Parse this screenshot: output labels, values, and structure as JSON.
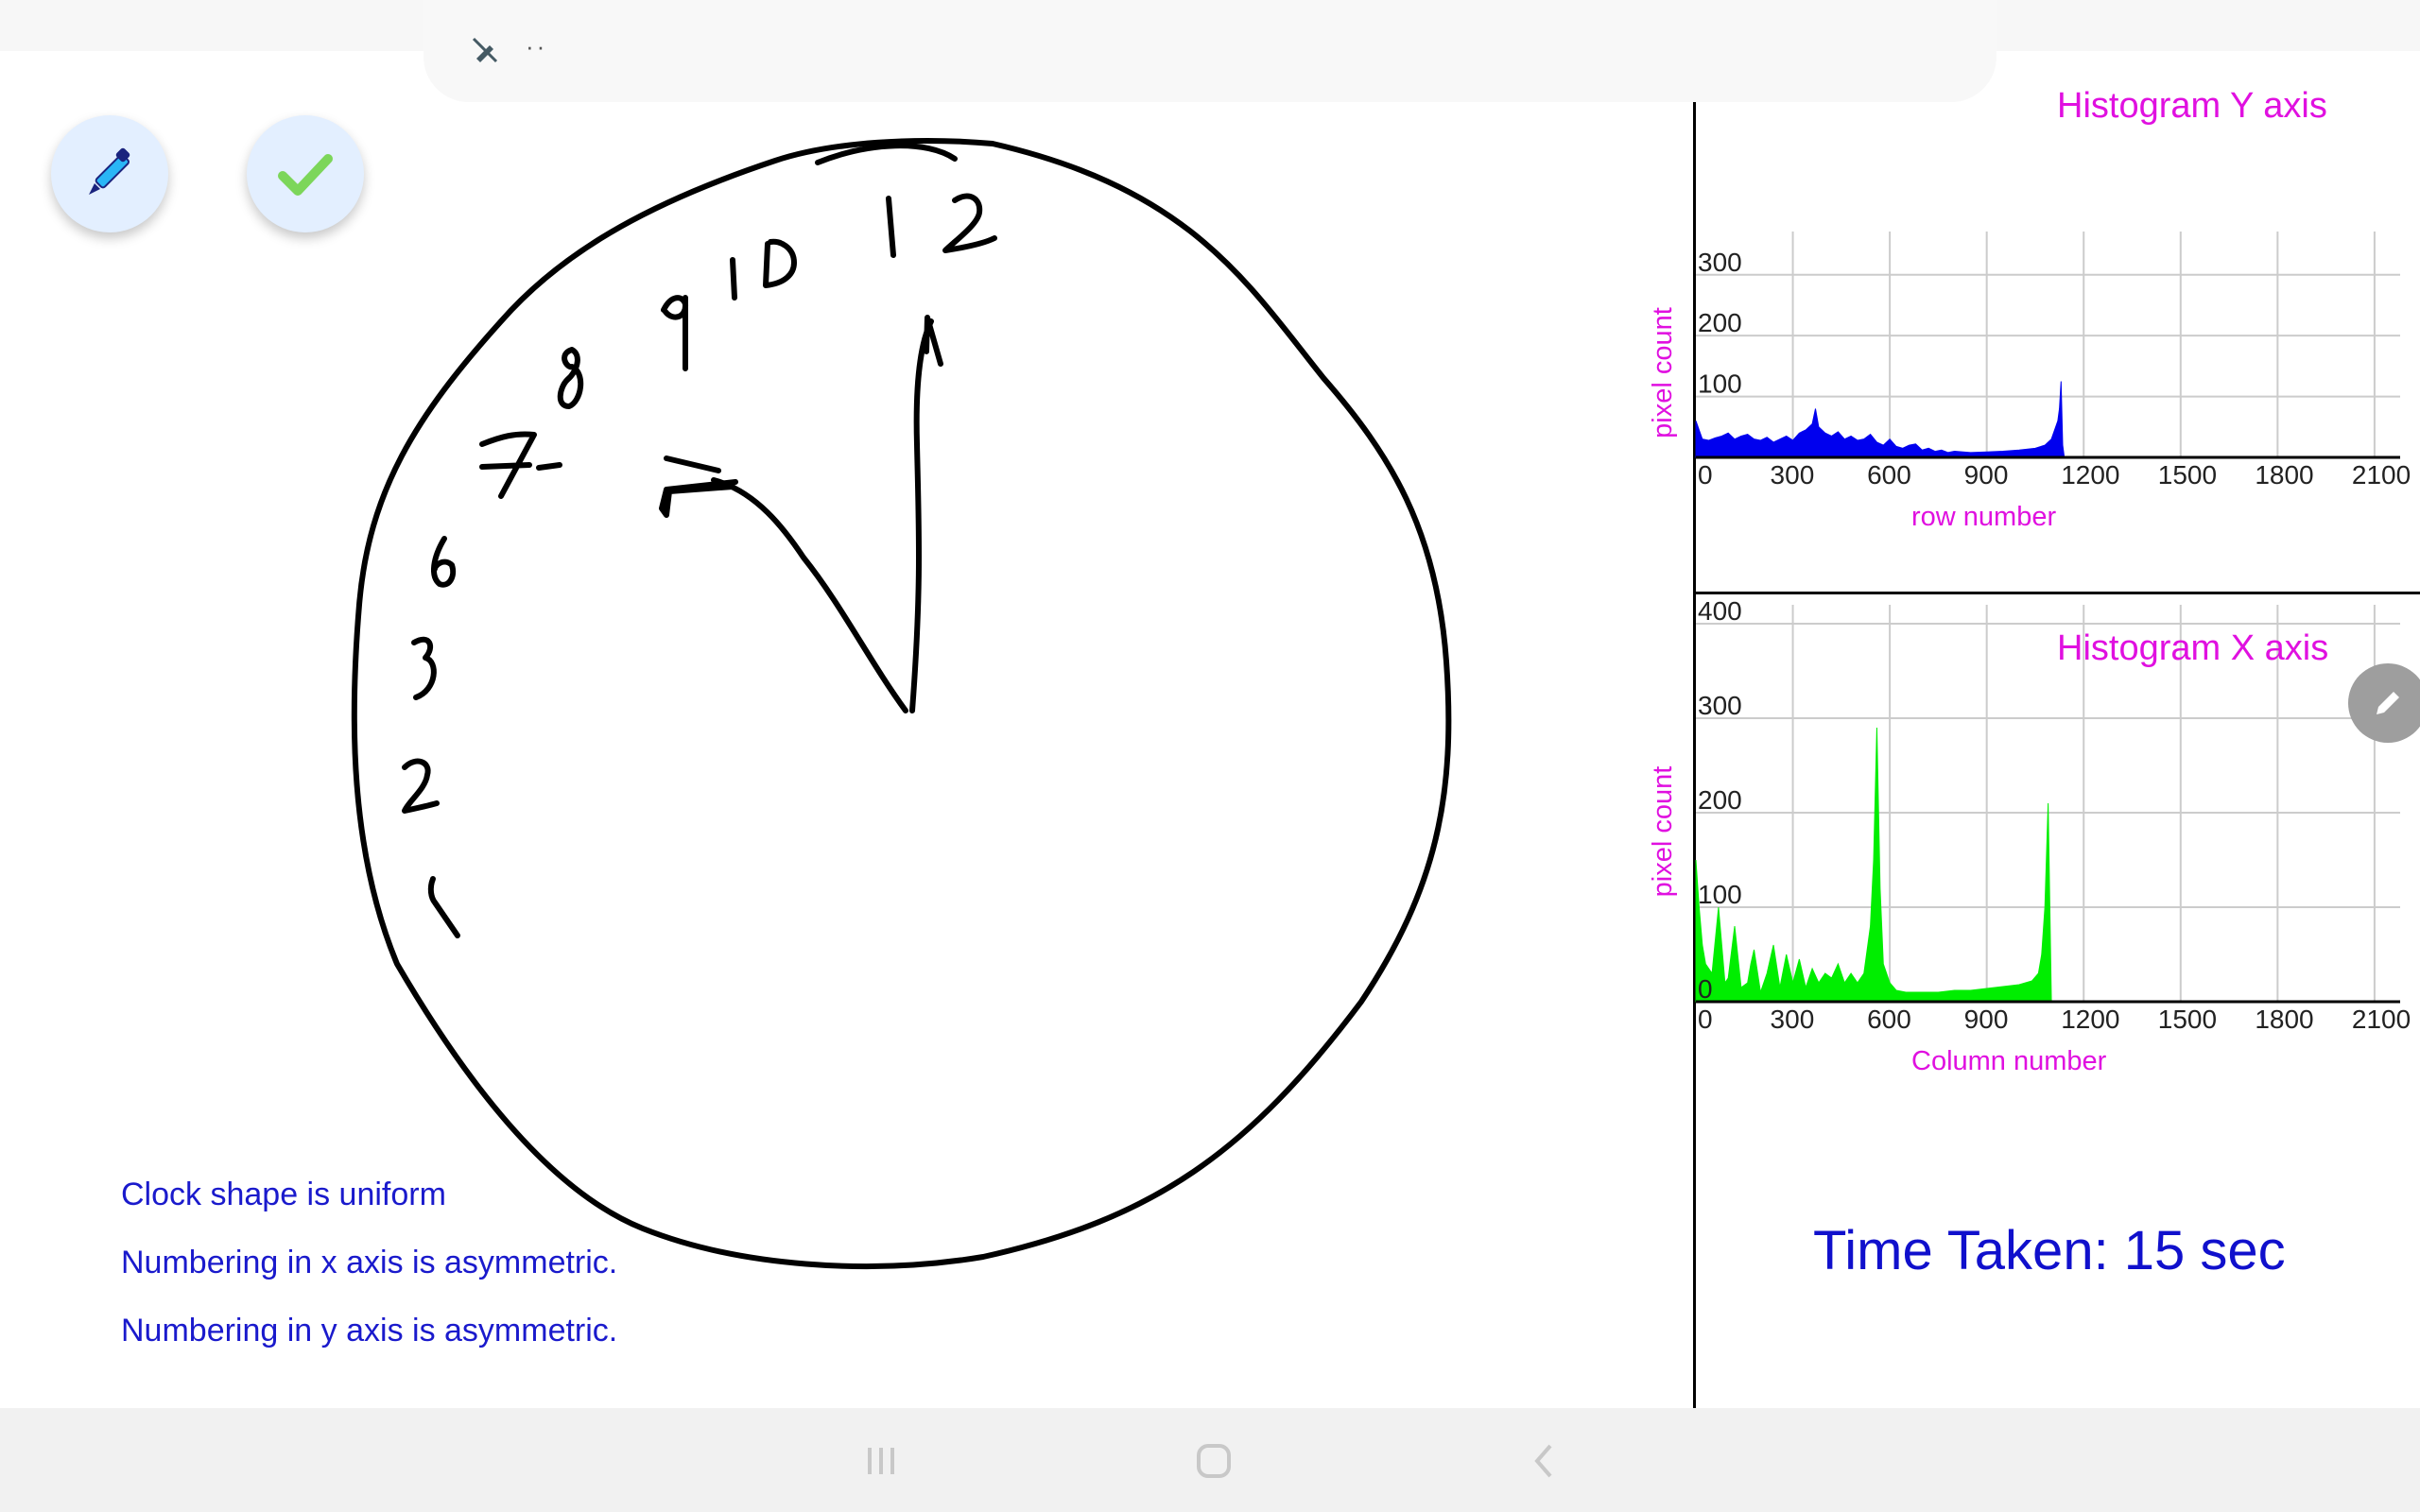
{
  "toolbar": {
    "icons": [
      "no-edit-icon",
      "more-dots-icon"
    ],
    "dots": "··"
  },
  "fabs": [
    {
      "name": "pen-tool-button",
      "icon": "pen-icon"
    },
    {
      "name": "confirm-button",
      "icon": "check-icon"
    }
  ],
  "clock_drawing": {
    "numbers": [
      "12",
      "10",
      "9",
      "8",
      "7",
      "6",
      "3",
      "2",
      "1"
    ]
  },
  "results": [
    "Clock shape is uniform",
    "Numbering in x axis is asymmetric.",
    "Numbering in y axis is asymmetric."
  ],
  "time_taken": "Time Taken: 15 sec",
  "colors": {
    "accent_text": "#e010e0",
    "result_text": "#1a1acc",
    "y_hist_fill": "#0000ee",
    "x_hist_fill": "#00ee00"
  },
  "chart_data": [
    {
      "type": "area",
      "title": "Histogram Y axis",
      "xlabel": "row number",
      "ylabel": "pixel count",
      "xlim": [
        0,
        2150
      ],
      "ylim": [
        0,
        340
      ],
      "xticks": [
        0,
        300,
        600,
        900,
        1200,
        1500,
        1800,
        2100
      ],
      "yticks": [
        100,
        200,
        300
      ],
      "grid": true,
      "series": [
        {
          "x": [
            0,
            10,
            20,
            40,
            60,
            80,
            100,
            120,
            140,
            160,
            180,
            200,
            220,
            240,
            260,
            280,
            300,
            320,
            340,
            360,
            370,
            380,
            400,
            420,
            440,
            460,
            480,
            500,
            520,
            540,
            560,
            580,
            600,
            620,
            640,
            660,
            680,
            700,
            720,
            740,
            760,
            780,
            800,
            850,
            900,
            950,
            1000,
            1050,
            1080,
            1100,
            1110,
            1120,
            1125,
            1130,
            1135,
            1140
          ],
          "y": [
            60,
            45,
            30,
            28,
            32,
            35,
            40,
            30,
            35,
            38,
            30,
            28,
            33,
            25,
            30,
            35,
            28,
            40,
            45,
            55,
            80,
            50,
            40,
            35,
            42,
            30,
            35,
            28,
            30,
            38,
            25,
            20,
            30,
            18,
            15,
            20,
            22,
            12,
            15,
            10,
            12,
            8,
            10,
            8,
            9,
            10,
            12,
            15,
            20,
            30,
            45,
            60,
            80,
            125,
            20,
            0
          ]
        }
      ]
    },
    {
      "type": "area",
      "title": "Histogram X axis",
      "xlabel": "Column number",
      "ylabel": "pixel count",
      "xlim": [
        0,
        2150
      ],
      "ylim": [
        0,
        400
      ],
      "xticks": [
        0,
        300,
        600,
        900,
        1200,
        1500,
        1800,
        2100
      ],
      "yticks": [
        0,
        100,
        200,
        300,
        400
      ],
      "grid": true,
      "series": [
        {
          "x": [
            0,
            10,
            20,
            30,
            50,
            70,
            90,
            100,
            120,
            140,
            160,
            170,
            180,
            200,
            220,
            240,
            260,
            280,
            300,
            320,
            340,
            360,
            380,
            400,
            420,
            440,
            460,
            480,
            500,
            520,
            540,
            550,
            560,
            570,
            580,
            600,
            620,
            650,
            700,
            750,
            800,
            850,
            900,
            950,
            1000,
            1040,
            1060,
            1070,
            1080,
            1090,
            1100
          ],
          "y": [
            150,
            100,
            60,
            40,
            30,
            100,
            20,
            25,
            80,
            15,
            20,
            40,
            55,
            10,
            30,
            60,
            15,
            50,
            20,
            45,
            15,
            35,
            20,
            30,
            25,
            40,
            20,
            30,
            20,
            30,
            80,
            150,
            290,
            120,
            40,
            20,
            12,
            10,
            10,
            10,
            12,
            12,
            14,
            16,
            18,
            22,
            30,
            50,
            100,
            210,
            0
          ]
        }
      ]
    }
  ]
}
